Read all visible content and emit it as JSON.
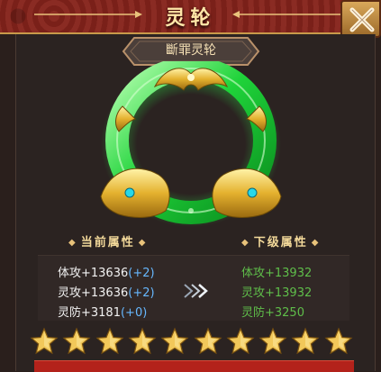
{
  "header": {
    "title": "灵轮"
  },
  "item": {
    "name": "斷罪灵轮"
  },
  "attributes": {
    "current_label": "当前属性",
    "next_label": "下级属性",
    "current": [
      {
        "text": "体攻+13636",
        "bonus": "(+2)"
      },
      {
        "text": "灵攻+13636",
        "bonus": "(+2)"
      },
      {
        "text": "灵防+3181",
        "bonus": "(+0)"
      }
    ],
    "next": [
      {
        "text": "体攻+13932"
      },
      {
        "text": "灵攻+13932"
      },
      {
        "text": "灵防+3250"
      }
    ]
  },
  "stars": {
    "filled": 10,
    "total": 10
  },
  "icons": [
    "close-icon",
    "arrow-right-icon",
    "star-icon",
    "diamond-icon"
  ],
  "colors": {
    "header_red": "#7b221b",
    "gold": "#f3d99a",
    "jade_green": "#3ddc4a",
    "bonus_blue": "#67b8ff",
    "next_green": "#5fbe4a"
  }
}
